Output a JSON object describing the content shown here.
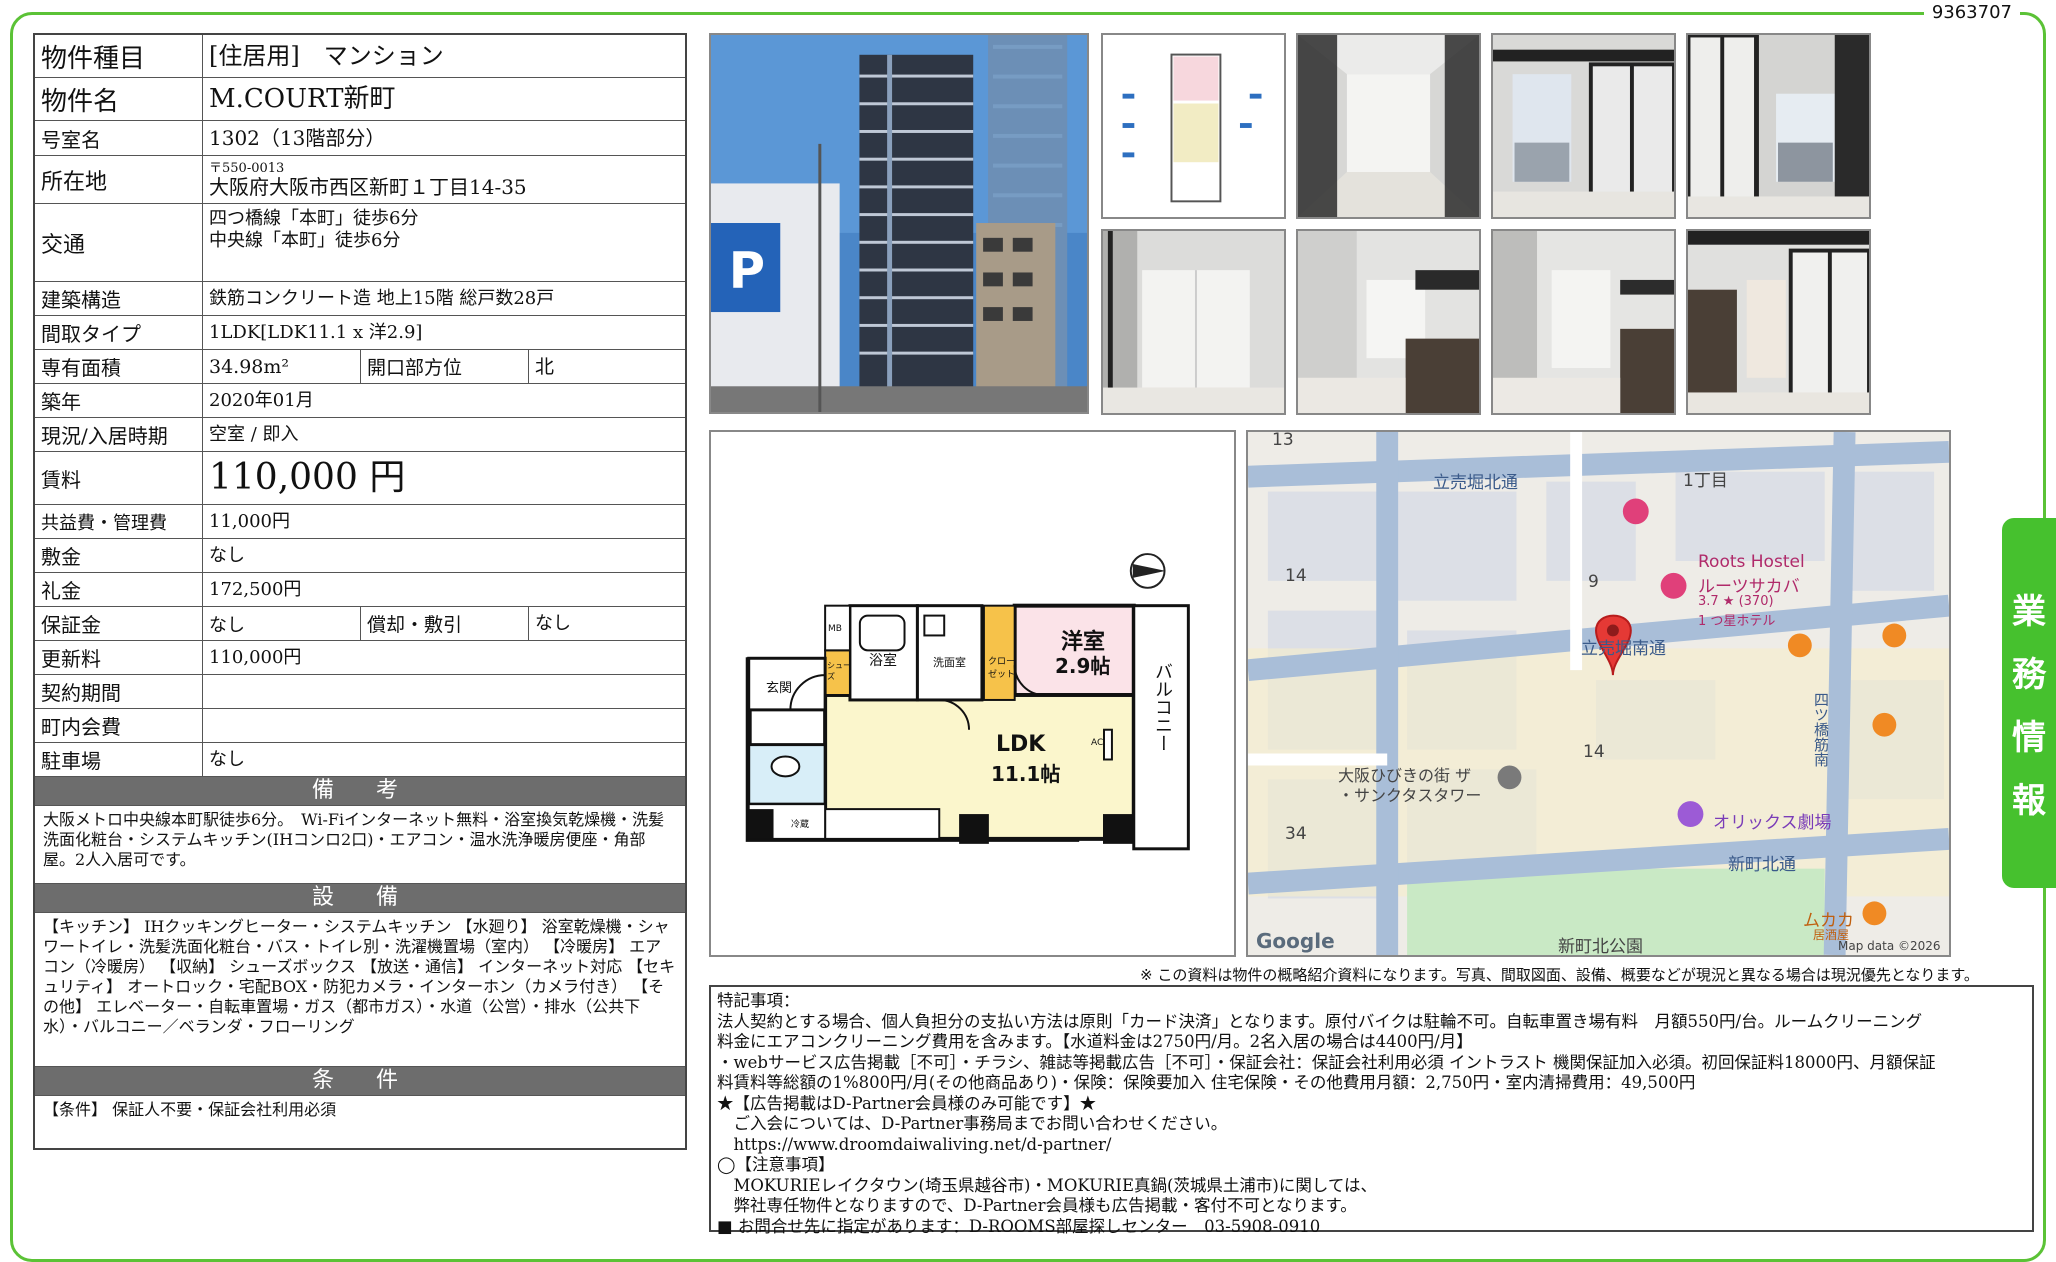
{
  "doc_id": "9363707",
  "side_tab": [
    "業",
    "務",
    "情",
    "報"
  ],
  "property": {
    "kind_label": "物件種目",
    "kind_value": "[住居用]　マンション",
    "name_label": "物件名",
    "name_value": "M.COURT新町",
    "room_label": "号室名",
    "room_value": "1302（13階部分）",
    "address_label": "所在地",
    "postal": "〒550-0013",
    "address_value": "大阪府大阪市西区新町１丁目14-35",
    "traffic_label": "交通",
    "traffic_1": "四つ橋線「本町」徒歩6分",
    "traffic_2": "中央線「本町」徒歩6分",
    "structure_label": "建築構造",
    "structure_value": "鉄筋コンクリート造 地上15階 総戸数28戸",
    "layout_label": "間取タイプ",
    "layout_value": "1LDK[LDK11.1 x 洋2.9]",
    "area_label": "専有面積",
    "area_value": "34.98m²",
    "direction_label": "開口部方位",
    "direction_value": "北",
    "built_label": "築年",
    "built_value": "2020年01月",
    "status_label": "現況/入居時期",
    "status_value": "空室 / 即入",
    "rent_label": "賃料",
    "rent_value": "110,000 円",
    "fee_label": "共益費・管理費",
    "fee_value": "11,000円",
    "deposit_label": "敷金",
    "deposit_value": "なし",
    "key_label": "礼金",
    "key_value": "172,500円",
    "guarantee_label": "保証金",
    "guarantee_value": "なし",
    "amort_label": "償却・敷引",
    "amort_value": "なし",
    "renew_label": "更新料",
    "renew_value": "110,000円",
    "period_label": "契約期間",
    "period_value": "",
    "assoc_label": "町内会費",
    "assoc_value": "",
    "parking_label": "駐車場",
    "parking_value": "なし"
  },
  "remarks": {
    "title": "備　考",
    "text": "大阪メトロ中央線本町駅徒歩6分。　Wi-Fiインターネット無料・浴室換気乾燥機・洗髪洗面化粧台・システムキッチン(IHコンロ2口)・エアコン・温水洗浄暖房便座・角部屋。2人入居可です。"
  },
  "equipment": {
    "title": "設　備",
    "text": "【キッチン】 IHクッキングヒーター・システムキッチン 【水廻り】 浴室乾燥機・シャワートイレ・洗髪洗面化粧台・バス・トイレ別・洗濯機置場（室内） 【冷暖房】 エアコン（冷暖房） 【収納】 シューズボックス 【放送・通信】 インターネット対応 【セキュリティ】 オートロック・宅配BOX・防犯カメラ・インターホン（カメラ付き） 【その他】 エレベーター・自転車置場・ガス（都市ガス）・水道（公営）・排水（公共下水）・バルコニー／ベランダ・フローリング"
  },
  "conditions": {
    "title": "条　件",
    "text": "【条件】 保証人不要・保証会社利用必須"
  },
  "floorplan": {
    "balcony": "バルコニー",
    "western_room": "洋室",
    "western_size": "2.9帖",
    "ldk": "LDK",
    "ldk_size": "11.1帖",
    "bath": "浴室",
    "washroom": "洗面室",
    "entrance": "玄関",
    "closet": "クロー\nゼット",
    "shoe": "シュー\nズ",
    "ac": "AC",
    "mb": "MB",
    "refrig": "冷蔵"
  },
  "map": {
    "labels": [
      "13",
      "立売堀北通",
      "1丁目",
      "14",
      "9",
      "Roots Hostel",
      "ルーツサカバ",
      "3.7 ★ (370)",
      "1 つ星ホテル",
      "立売堀南通",
      "14",
      "大阪ひびきの街 ザ",
      "・サンクタスタワー",
      "オリックス劇場",
      "34",
      "新町北通",
      "ムカカ",
      "居酒屋",
      "Google",
      "新町北公園",
      "Map data ©2026",
      "四ツ橋筋南"
    ]
  },
  "notice": "※ この資料は物件の概略紹介資料になります。写真、間取図面、設備、概要などが現況と異なる場合は現況優先となります。",
  "special": {
    "lines": [
      "特記事項：",
      "法人契約とする場合、個人負担分の支払い方法は原則「カード決済」となります。原付バイクは駐輪不可。自転車置き場有料　月額550円/台。ルームクリーニング",
      "料金にエアコンクリーニング費用を含みます。【水道料金は2750円/月。2名入居の場合は4400円/月】",
      "・webサービス広告掲載［不可］・チラシ、雑誌等掲載広告［不可］・保証会社：保証会社利用必須 イントラスト 機関保証加入必須。初回保証料18000円、月額保証",
      "料賃料等総額の1%800円/月(その他商品あり)・保険：保険要加入 住宅保険・その他費用月額：2,750円・室内清掃費用：49,500円",
      "★【広告掲載はD-Partner会員様のみ可能です】★",
      "　ご入会については、D-Partner事務局までお問い合わせください。",
      "　https://www.droomdaiwaliving.net/d-partner/",
      "◯【注意事項】",
      "　MOKURIEレイクタウン(埼玉県越谷市)・MOKURIE真鍋(茨城県土浦市)に関しては、",
      "　弊社専任物件となりますので、D-Partner会員様も広告掲載・客付不可となります。",
      "■ お問合せ先に指定があります：D-ROOMS部屋探しセンター　03-5908-0910"
    ]
  }
}
